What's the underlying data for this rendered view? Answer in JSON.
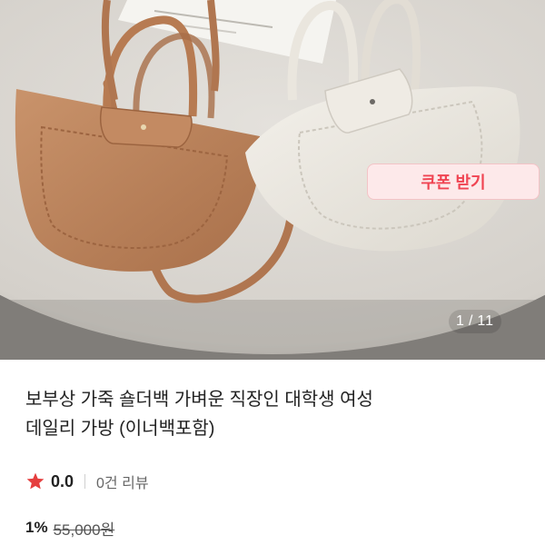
{
  "gallery": {
    "counter_current": "1",
    "counter_separator": "/",
    "counter_total": "11"
  },
  "product": {
    "title_line1": "보부상 가죽 숄더백 가벼운 직장인 대학생 여성",
    "title_line2": "데일리 가방 (이너백포함)"
  },
  "rating": {
    "score": "0.0",
    "review_count": "0건 리뷰",
    "star_color": "#e53e3e"
  },
  "price": {
    "discount": "1%",
    "original": "55,000원"
  },
  "coupon": {
    "label": "쿠폰 받기",
    "accent": "#f04452"
  }
}
